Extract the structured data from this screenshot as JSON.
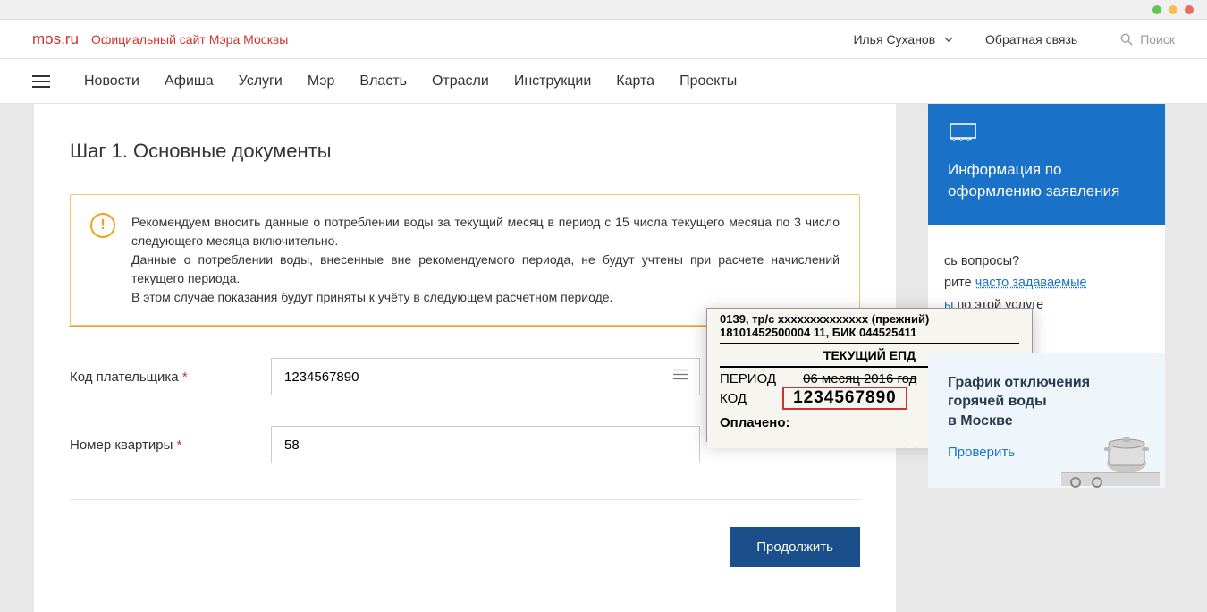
{
  "brand": {
    "name": "mos.ru",
    "tagline": "Официальный сайт Мэра Москвы"
  },
  "header": {
    "user": "Илья Суханов",
    "feedback": "Обратная связь",
    "search_placeholder": "Поиск"
  },
  "nav": {
    "items": [
      "Новости",
      "Афиша",
      "Услуги",
      "Мэр",
      "Власть",
      "Отрасли",
      "Инструкции",
      "Карта",
      "Проекты"
    ]
  },
  "step": {
    "title": "Шаг 1. Основные документы"
  },
  "notice": {
    "line1": "Рекомендуем вносить данные о потреблении воды за текущий месяц в период с 15 числа текущего месяца по 3 число следующего месяца включительно.",
    "line2": "Данные о потреблении воды, внесенные вне рекомендуемого периода, не будут учтены при расчете начислений текущего периода.",
    "line3": "В этом случае показания будут приняты к учёту в следующем расчетном периоде."
  },
  "form": {
    "payer_code": {
      "label": "Код плательщика",
      "value": "1234567890"
    },
    "apartment": {
      "label": "Номер квартиры",
      "value": "58"
    },
    "submit": "Продолжить"
  },
  "receipt": {
    "row1": "0139, тр/с хххххххххххххх (прежний)",
    "row2": "18101452500004 11, БИК 044525411",
    "title": "ТЕКУЩИЙ ЕПД",
    "period_label": "ПЕРИОД",
    "period_value": "06   месяц   2016  год",
    "code_label": "КОД",
    "code_value": "1234567890",
    "paid_label": "Оплачено:"
  },
  "sidebar": {
    "info_title": "Информация по оформлению заявления",
    "faq_q": "сь вопросы?",
    "faq_pre": "рите ",
    "faq_link": "часто задаваемые",
    "faq_after": "ы",
    "faq_tail": " по этой услуге",
    "promo_title": "График отключения горячей воды\nв Москве",
    "promo_link": "Проверить"
  }
}
